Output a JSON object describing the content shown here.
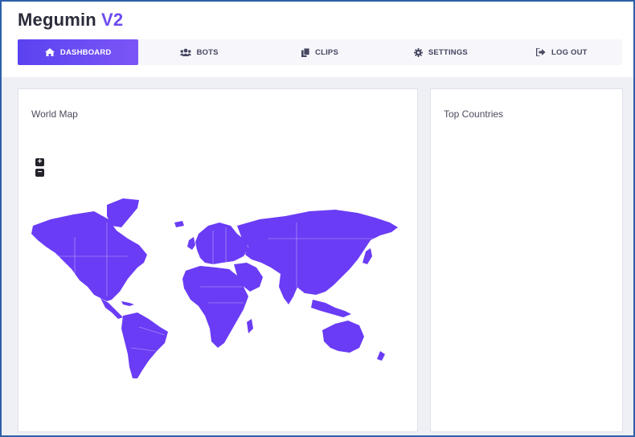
{
  "app": {
    "name": "Megumin",
    "version": "V2"
  },
  "nav": {
    "items": [
      {
        "label": "DASHBOARD",
        "icon": "home-icon",
        "active": true
      },
      {
        "label": "BOTS",
        "icon": "users-icon",
        "active": false
      },
      {
        "label": "CLIPS",
        "icon": "copy-icon",
        "active": false
      },
      {
        "label": "SETTINGS",
        "icon": "gear-icon",
        "active": false
      },
      {
        "label": "LOG OUT",
        "icon": "sign-out-icon",
        "active": false
      }
    ]
  },
  "map_card": {
    "title": "World Map",
    "zoom_in": "+",
    "zoom_out": "−"
  },
  "countries_card": {
    "title": "Top Countries"
  },
  "colors": {
    "accent": "#6f4cf0",
    "map_fill": "#6a3cf5",
    "background": "#eef0f5"
  }
}
